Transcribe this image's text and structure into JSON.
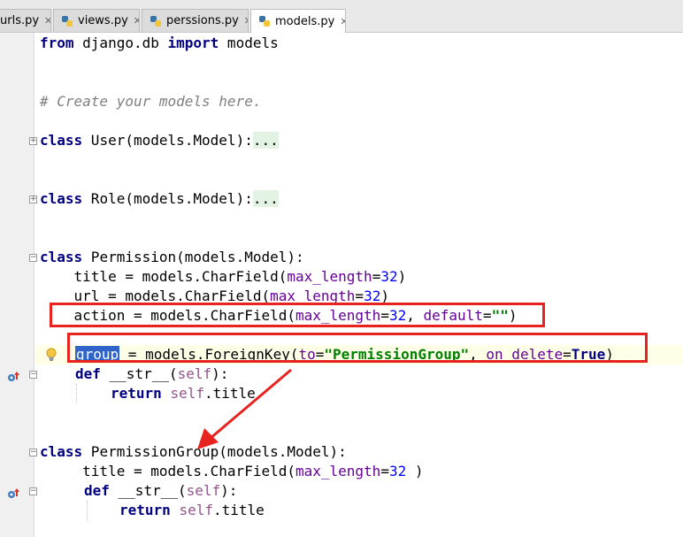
{
  "tabs": [
    {
      "label": "urls.py",
      "close": "✕",
      "active": false
    },
    {
      "label": "views.py",
      "close": "✕",
      "active": false
    },
    {
      "label": "perssions.py",
      "close": "✕",
      "active": false
    },
    {
      "label": "models.py",
      "close": "✕",
      "active": true
    }
  ],
  "code": {
    "l1": {
      "kw1": "from",
      "mod": " django.db ",
      "kw2": "import",
      "rest": " models"
    },
    "l2": {
      "comment": "# Create your models here."
    },
    "l3": {
      "kw": "class",
      "name": " User(models.Model):",
      "fold": "..."
    },
    "l4": {
      "kw": "class",
      "name": " Role(models.Model):",
      "fold": "..."
    },
    "l5": {
      "kw": "class",
      "name": " Permission(models.Model):"
    },
    "l6": {
      "a": "    title = models.CharField(",
      "p": "max_length",
      "eq": "=",
      "n": "32",
      "z": ")"
    },
    "l7": {
      "a": "    url = models.CharField(",
      "p": "max_length",
      "eq": "=",
      "n": "32",
      "z": ")"
    },
    "l8": {
      "a": "    action = models.CharField(",
      "p": "max_length",
      "eq": "=",
      "n": "32",
      "c": ", ",
      "p2": "default",
      "eq2": "=",
      "s": "\"\"",
      "z": ")"
    },
    "l9": {
      "sel": "group",
      "a": " = models.ForeignKey(",
      "p": "to",
      "eq": "=",
      "s": "\"PermissionGroup\"",
      "c": ", ",
      "p2": "on_delete",
      "eq2": "=",
      "t": "True",
      "z": ")"
    },
    "l10": {
      "kw": "def",
      "a": " __str__(",
      "self": "self",
      "z": "):"
    },
    "l11": {
      "kw": "return",
      "sp": " ",
      "self": "self",
      "a": ".title"
    },
    "l12": {
      "kw": "class",
      "name": " PermissionGroup(models.Model):"
    },
    "l13": {
      "a": "     title = models.CharField(",
      "p": "max_length",
      "eq": "=",
      "n": "32",
      "z": " )"
    },
    "l14": {
      "kw": "def",
      "a": " __str__(",
      "self": "self",
      "z": "):"
    },
    "l15": {
      "kw": "return",
      "sp": " ",
      "self": "self",
      "a": ".title"
    }
  },
  "colors": {
    "annotation": "#e8231f",
    "keyword": "#000080",
    "param": "#660099",
    "number": "#0000ff",
    "string": "#008000"
  }
}
